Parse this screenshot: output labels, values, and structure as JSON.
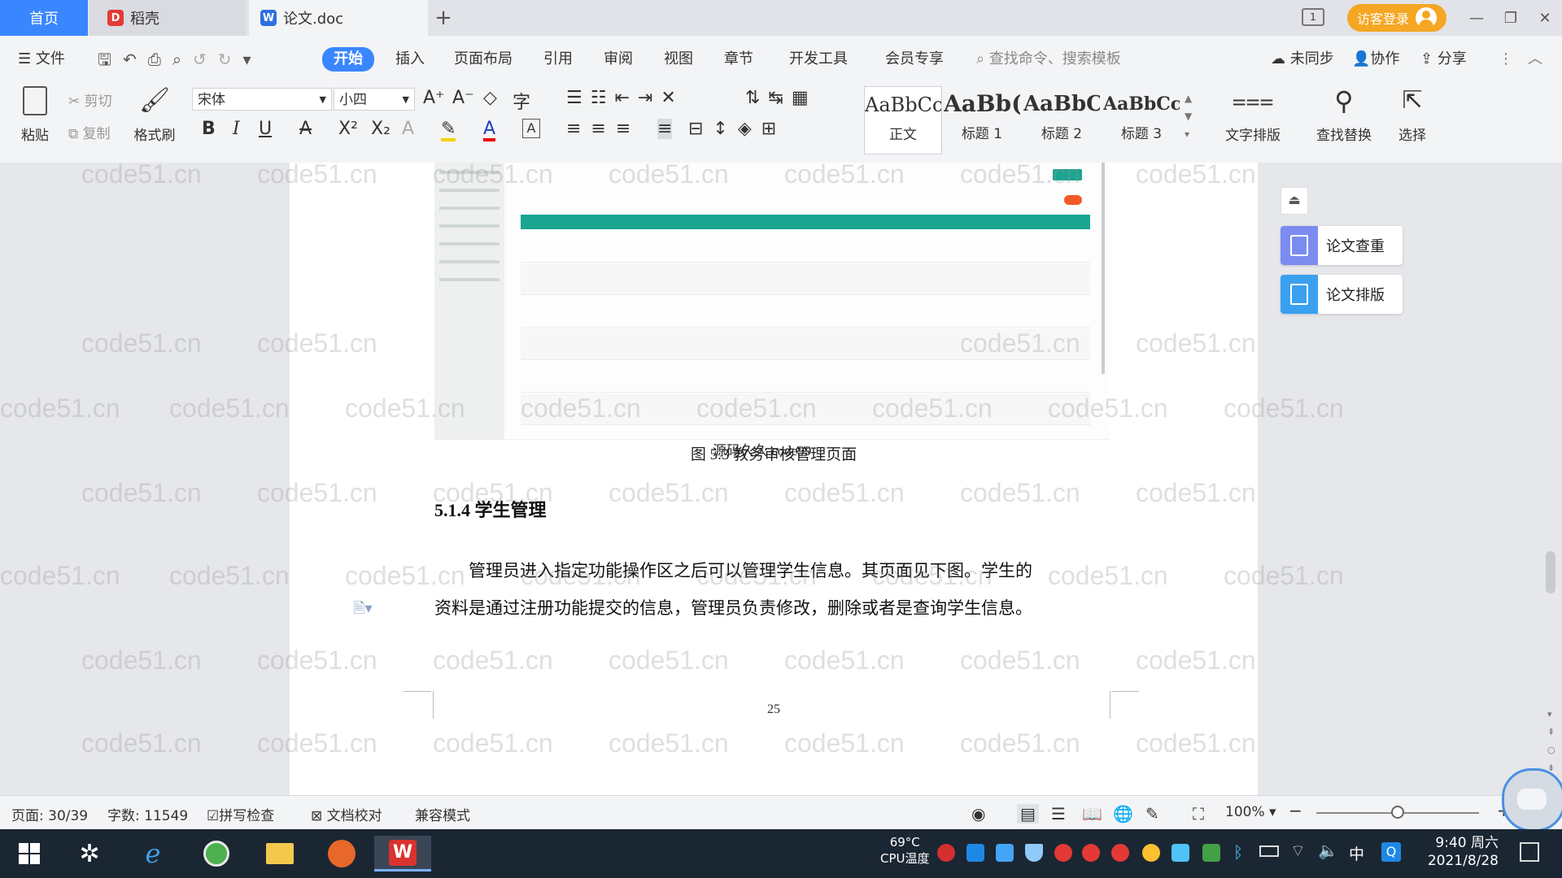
{
  "titlebar": {
    "tabs": [
      {
        "label": "首页"
      },
      {
        "label": "稻壳"
      },
      {
        "label": "论文.doc"
      }
    ],
    "visitor_login": "访客登录"
  },
  "menubar": {
    "file": "文件",
    "items": [
      "开始",
      "插入",
      "页面布局",
      "引用",
      "审阅",
      "视图",
      "章节",
      "开发工具",
      "会员专享"
    ],
    "search_placeholder": "查找命令、搜索模板",
    "sync": "未同步",
    "collab": "协作",
    "share": "分享"
  },
  "ribbon": {
    "paste": "粘贴",
    "cut": "剪切",
    "copy": "复制",
    "format_painter": "格式刷",
    "font_name": "宋体",
    "font_size": "小四",
    "styles": [
      {
        "preview": "AaBbCcI",
        "name": "正文"
      },
      {
        "preview": "AaBb(",
        "name": "标题 1"
      },
      {
        "preview": "AaBbC",
        "name": "标题 2"
      },
      {
        "preview": "AaBbCcI",
        "name": "标题 3"
      }
    ],
    "text_layout": "文字排版",
    "find_replace": "查找替换",
    "select": "选择"
  },
  "document": {
    "watermark": "code51.cn",
    "figure_overlay": "源码久久 code99",
    "figure_caption": "图 5.3 教务审核管理页面",
    "section_heading": "5.1.4  学生管理",
    "paragraph_line1": "管理员进入指定功能操作区之后可以管理学生信息。其页面见下图。学生的",
    "paragraph_line2": "资料是通过注册功能提交的信息，管理员负责修改，删除或者是查询学生信息。",
    "page_number": "25"
  },
  "right_panel": {
    "check": "论文查重",
    "layout": "论文排版"
  },
  "statusbar": {
    "page": "页面: 30/39",
    "words": "字数: 11549",
    "spell": "拼写检查",
    "proof": "文档校对",
    "compat": "兼容模式",
    "zoom": "100%",
    "zoom_level": 0.5
  },
  "taskbar": {
    "cpu_temp": "69°C",
    "cpu_label": "CPU温度",
    "ime": "中",
    "time": "9:40 周六",
    "date": "2021/8/28"
  },
  "colors": {
    "accent": "#3a86ff",
    "visitor": "#f5a623",
    "table_header": "#1aa591"
  }
}
